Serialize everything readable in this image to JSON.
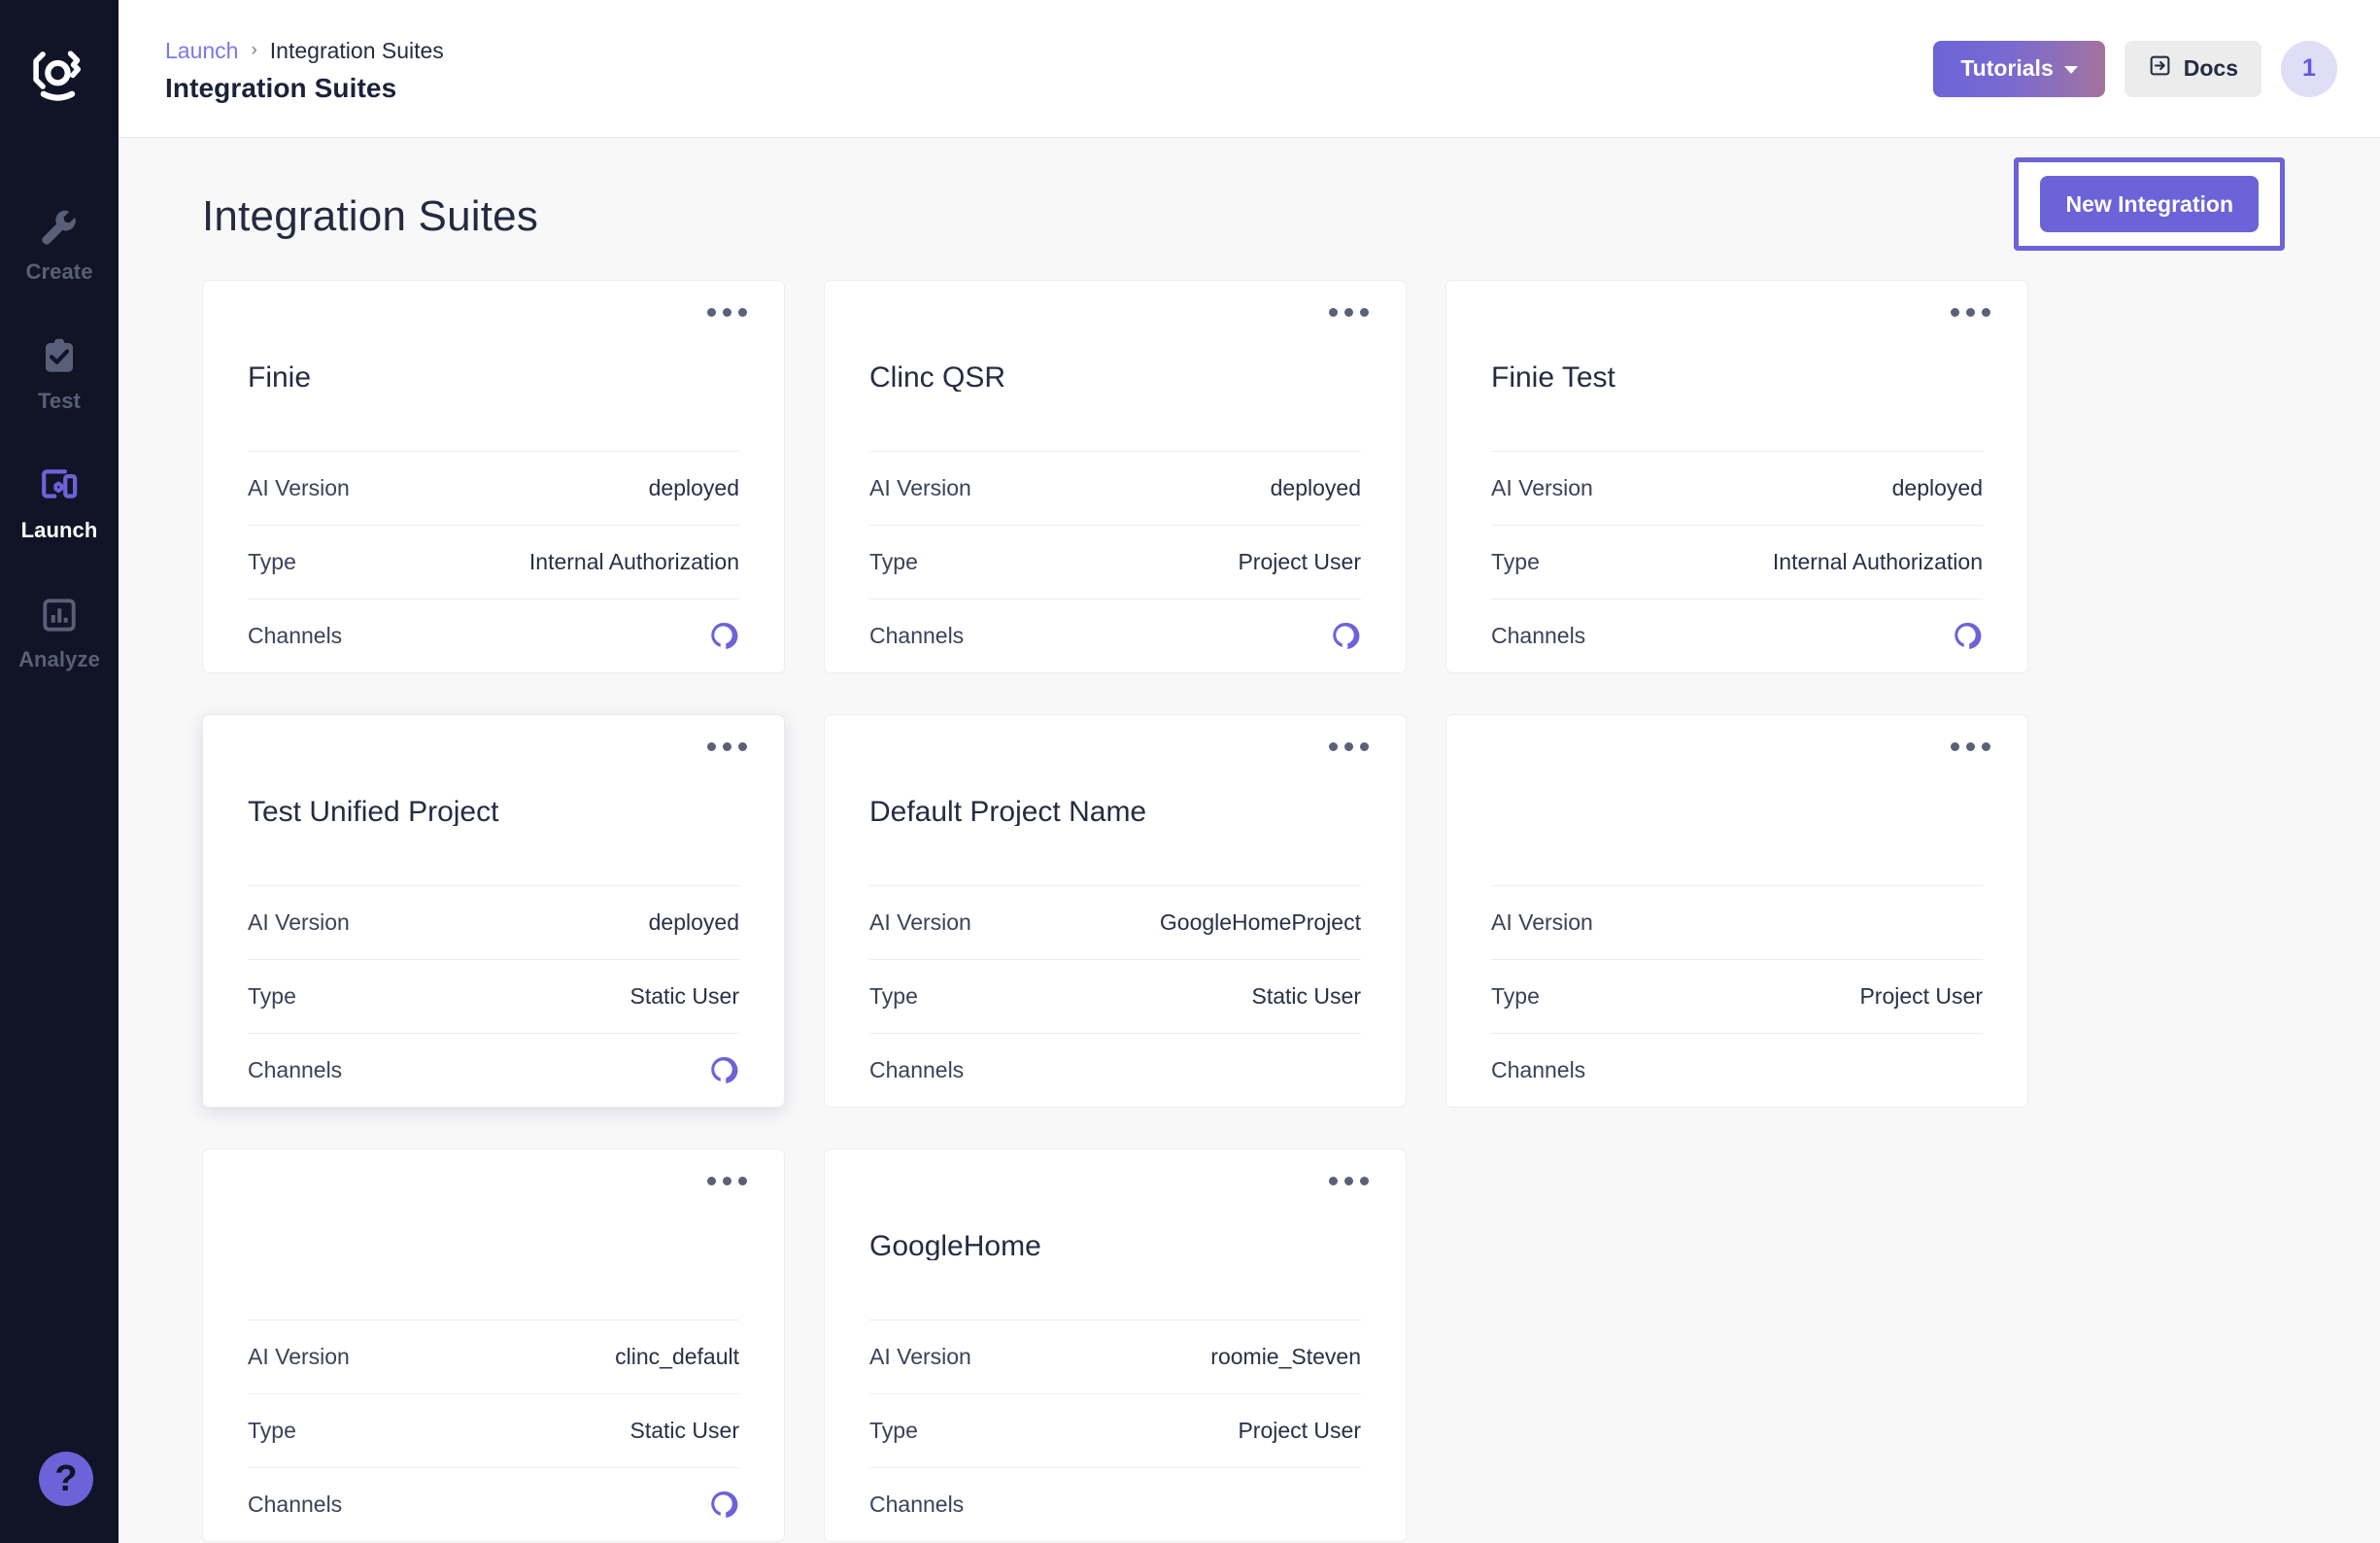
{
  "sidebar": {
    "logo_icon": "clinc-logo-icon",
    "items": [
      {
        "label": "Create",
        "icon": "wrench-icon",
        "active": false
      },
      {
        "label": "Test",
        "icon": "clipboard-check-icon",
        "active": false
      },
      {
        "label": "Launch",
        "icon": "devices-icon",
        "active": true
      },
      {
        "label": "Analyze",
        "icon": "bar-chart-icon",
        "active": false
      }
    ],
    "help_label": "?"
  },
  "topbar": {
    "breadcrumb": {
      "parent": "Launch",
      "separator": "›",
      "current": "Integration Suites"
    },
    "title": "Integration Suites",
    "tutorials_label": "Tutorials",
    "docs_label": "Docs",
    "docs_icon": "external-link-icon",
    "avatar_label": "1"
  },
  "content": {
    "heading": "Integration Suites",
    "new_integration_label": "New Integration",
    "labels": {
      "ai_version": "AI Version",
      "type": "Type",
      "channels": "Channels"
    },
    "cards": [
      {
        "title": "Finie",
        "ai_version": "deployed",
        "type": "Internal Authorization",
        "channel_icon": "alexa-icon",
        "hovered": false
      },
      {
        "title": "Clinc QSR",
        "ai_version": "deployed",
        "type": "Project User",
        "channel_icon": "alexa-icon",
        "hovered": false
      },
      {
        "title": "Finie Test",
        "ai_version": "deployed",
        "type": "Internal Authorization",
        "channel_icon": "alexa-icon",
        "hovered": false
      },
      {
        "title": "Test Unified Project",
        "ai_version": "deployed",
        "type": "Static User",
        "channel_icon": "alexa-icon",
        "hovered": true
      },
      {
        "title": "Default Project Name",
        "ai_version": "GoogleHomeProject",
        "type": "Static User",
        "channel_icon": "",
        "hovered": false
      },
      {
        "title": "",
        "ai_version": "",
        "type": "Project User",
        "channel_icon": "",
        "hovered": false
      },
      {
        "title": "",
        "ai_version": "clinc_default",
        "type": "Static User",
        "channel_icon": "alexa-icon",
        "hovered": false
      },
      {
        "title": "GoogleHome",
        "ai_version": "roomie_Steven",
        "type": "Project User",
        "channel_icon": "",
        "hovered": false
      }
    ]
  },
  "colors": {
    "sidebar_bg": "#111427",
    "accent_purple": "#6c63d8",
    "link_purple": "#7d77e8",
    "page_bg": "#f8f8f9",
    "card_bg": "#ffffff",
    "text_dark": "#262b42"
  }
}
